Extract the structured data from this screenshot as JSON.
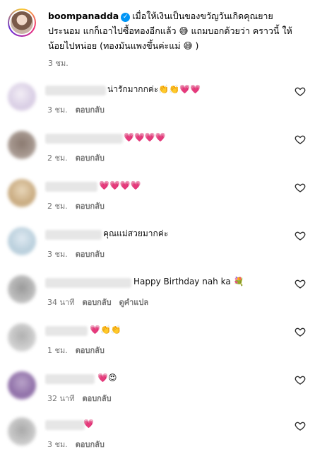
{
  "post": {
    "username": "boompanadda",
    "text": "เมื่อให้เงินเป็นของขวัญวันเกิดคุณยาย ประนอม แกก็เอาไปซื้อทองอีกแล้ว 😅 แถมบอกด้วยว่า คราวนี้ ให้น้อยไปหน่อย (ทองมันแพงขึ้นค่ะแม่ 😅 )",
    "time": "3 ชม."
  },
  "reply_label": "ตอบกลับ",
  "translate_label": "ดูคำแปล",
  "comments": [
    {
      "text": "น่ารักมากกค่ะ👏👏💗💗",
      "time": "3 ชม."
    },
    {
      "text": "💗💗💗💗",
      "time": "2 ชม."
    },
    {
      "text": "💗💗💗💗",
      "time": "2 ชม."
    },
    {
      "text": "คุณแม่สวยมากค่ะ",
      "time": "3 ชม."
    },
    {
      "text": "Happy Birthday nah ka 💐",
      "time": "34 นาที"
    },
    {
      "text": "💗👏👏",
      "time": "1 ชม."
    },
    {
      "text": "💗😍",
      "time": "32 นาที"
    },
    {
      "text": "💗",
      "time": "3 ชม."
    }
  ],
  "colors": {
    "accent": "#0095f6",
    "muted": "#737373"
  }
}
